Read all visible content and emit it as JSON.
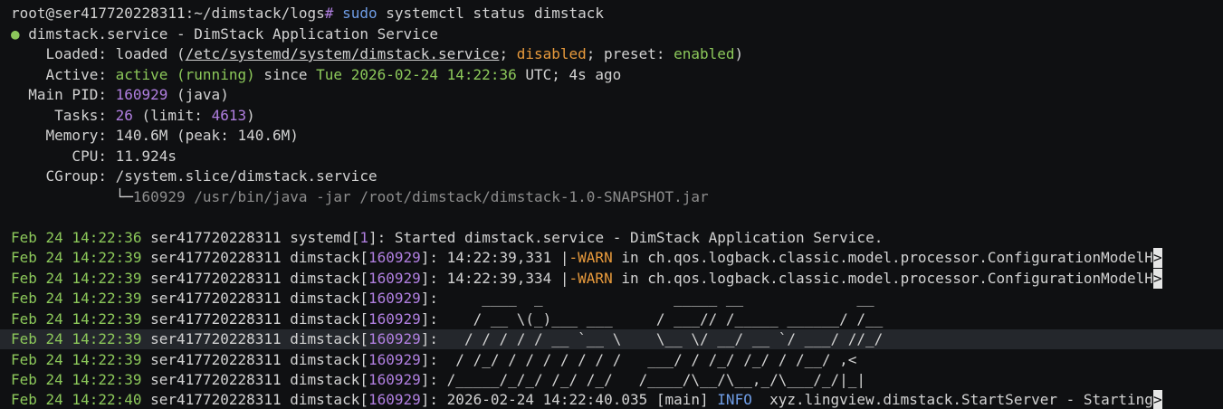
{
  "terminal": {
    "prompt": {
      "user_host": "root@ser417720228311",
      "path": ":~/dimstack/logs",
      "symbol": "#",
      "command_sudo": "sudo",
      "command_rest": " systemctl status dimstack"
    },
    "status": {
      "bullet": "●",
      "header": " dimstack.service - DimStack Application Service",
      "loaded_label": "    Loaded: ",
      "loaded_value": "loaded (",
      "loaded_path": "/etc/systemd/system/dimstack.service",
      "loaded_sep1": "; ",
      "loaded_disabled": "disabled",
      "loaded_sep2": "; preset: ",
      "loaded_preset": "enabled",
      "loaded_close": ")",
      "active_label": "    Active: ",
      "active_state": "active (running)",
      "active_since": " since ",
      "active_time": "Tue 2026-02-24 14:22:36",
      "active_tail": " UTC; 4s ago",
      "mainpid_label": "  Main PID: ",
      "mainpid_value": "160929",
      "mainpid_tail": " (java)",
      "tasks_label": "     Tasks: ",
      "tasks_value": "26",
      "tasks_limit_pre": " (limit: ",
      "tasks_limit": "4613",
      "tasks_limit_post": ")",
      "memory_label": "    Memory: ",
      "memory_value": "140.6M (peak: 140.6M)",
      "cpu_label": "       CPU: ",
      "cpu_value": "11.924s",
      "cgroup_label": "    CGroup: ",
      "cgroup_value": "/system.slice/dimstack.service",
      "cgroup_tree": "            └─",
      "cgroup_process": "160929 /usr/bin/java -jar /root/dimstack/dimstack-1.0-SNAPSHOT.jar"
    },
    "logs": [
      {
        "date": "Feb 24 14:22:36",
        "host": " ser417720228311 ",
        "unit": "systemd",
        "pid": "1",
        "msg": ": Started dimstack.service - DimStack Application Service."
      },
      {
        "date": "Feb 24 14:22:39",
        "host": " ser417720228311 ",
        "unit": "dimstack",
        "pid": "160929",
        "msg_time": ": 14:22:39,331 |",
        "msg_level": "-WARN",
        "msg_rest": " in ch.qos.logback.classic.model.processor.ConfigurationModelH"
      },
      {
        "date": "Feb 24 14:22:39",
        "host": " ser417720228311 ",
        "unit": "dimstack",
        "pid": "160929",
        "msg_time": ": 14:22:39,334 |",
        "msg_level": "-WARN",
        "msg_rest": " in ch.qos.logback.classic.model.processor.ConfigurationModelH"
      },
      {
        "date": "Feb 24 14:22:39",
        "host": " ser417720228311 ",
        "unit": "dimstack",
        "pid": "160929",
        "msg": ":     ____  _               _____ __             __"
      },
      {
        "date": "Feb 24 14:22:39",
        "host": " ser417720228311 ",
        "unit": "dimstack",
        "pid": "160929",
        "msg": ":    / __ \\(_)___ ___     / ___// /_____ ______/ /__"
      },
      {
        "date": "Feb 24 14:22:39",
        "host": " ser417720228311 ",
        "unit": "dimstack",
        "pid": "160929",
        "msg": ":   / / / / / __ `__ \\    \\__ \\/ __/ __ `/ ___/ //_/"
      },
      {
        "date": "Feb 24 14:22:39",
        "host": " ser417720228311 ",
        "unit": "dimstack",
        "pid": "160929",
        "msg": ":  / /_/ / / / / / / /   ___/ / /_/ /_/ / /__/ ,<"
      },
      {
        "date": "Feb 24 14:22:39",
        "host": " ser417720228311 ",
        "unit": "dimstack",
        "pid": "160929",
        "msg": ": /_____/_/_/ /_/ /_/   /____/\\__/\\__,_/\\___/_/|_|"
      },
      {
        "date": "Feb 24 14:22:40",
        "host": " ser417720228311 ",
        "unit": "dimstack",
        "pid": "160929",
        "msg_time": ": 2026-02-24 14:22:40.035 [main] ",
        "msg_level": "INFO",
        "msg_rest": "  xyz.lingview.dimstack.StartServer - Starting"
      }
    ],
    "overflow_marker": ">"
  },
  "colors": {
    "background": "#0f1012",
    "text": "#d2d2d2",
    "green": "#8cc85a",
    "purple": "#b07fe0",
    "orange": "#e89a3c",
    "blue": "#6f9de6",
    "dim": "#8d8d8d",
    "highlight_row": "#24272c"
  }
}
